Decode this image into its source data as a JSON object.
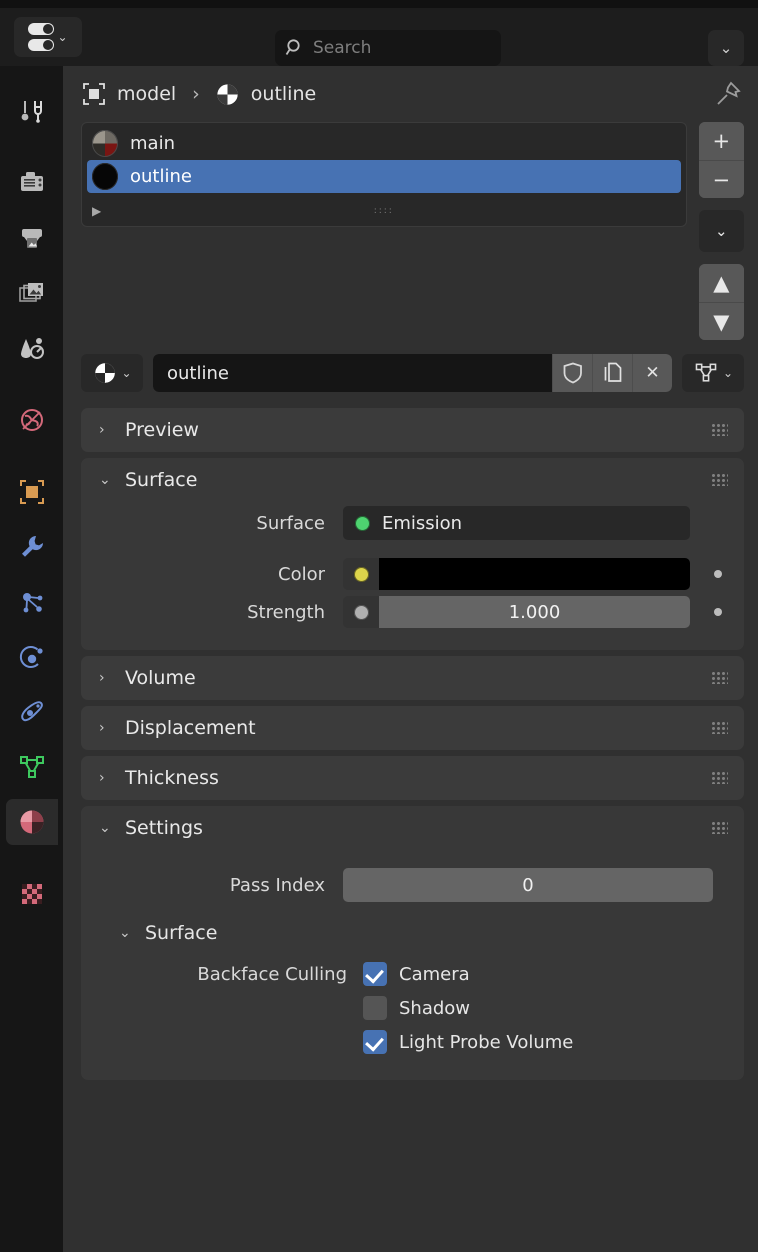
{
  "window": {
    "editor_type_icon": "properties-editor-icon",
    "editor_type_chevron": "⌄"
  },
  "header": {
    "search": {
      "placeholder": "Search",
      "value": "",
      "icon": "search-icon"
    },
    "right_menu_chevron": "⌄"
  },
  "tabs": [
    {
      "name": "tool",
      "icon": "tool-icon",
      "active": false
    },
    {
      "name": "render",
      "icon": "camera-back-icon",
      "active": false
    },
    {
      "name": "output",
      "icon": "printer-icon",
      "active": false
    },
    {
      "name": "view-layer",
      "icon": "images-icon",
      "active": false
    },
    {
      "name": "scene",
      "icon": "cone-droplet-icon",
      "active": false
    },
    {
      "name": "world",
      "icon": "globe-icon",
      "active": false
    },
    {
      "name": "object",
      "icon": "object-square-icon",
      "active": false
    },
    {
      "name": "modifiers",
      "icon": "wrench-icon",
      "active": false
    },
    {
      "name": "particles",
      "icon": "particles-icon",
      "active": false
    },
    {
      "name": "physics",
      "icon": "physics-orbit-icon",
      "active": false
    },
    {
      "name": "object-constraints",
      "icon": "constraint-icon",
      "active": false
    },
    {
      "name": "object-data",
      "icon": "mesh-data-icon",
      "active": false
    },
    {
      "name": "material",
      "icon": "material-sphere-icon",
      "active": true
    },
    {
      "name": "texture",
      "icon": "checker-texture-icon",
      "active": false
    }
  ],
  "breadcrumb": {
    "object_icon": "object-square-icon",
    "object_name": "model",
    "separator": "›",
    "material_icon": "material-sphere-icon",
    "material_name": "outline",
    "pin_icon": "pin-icon"
  },
  "material_slots": {
    "items": [
      {
        "name": "main",
        "preview": "sphere-preview-grey-red",
        "selected": false
      },
      {
        "name": "outline",
        "preview": "sphere-preview-black",
        "selected": true
      }
    ],
    "footer": {
      "expand_arrow": "▶",
      "grip": "::::"
    },
    "buttons": {
      "add": "+",
      "remove": "−",
      "specials_chevron": "⌄",
      "move_up": "▲",
      "move_down": "▼"
    }
  },
  "material_id": {
    "browse_icon": "material-sphere-icon",
    "browse_chevron": "⌄",
    "name_value": "outline",
    "fake_user_icon": "shield-icon",
    "duplicate_icon": "copy-icon",
    "unlink_icon": "✕",
    "link_icon": "mesh-data-icon",
    "link_chevron": "⌄"
  },
  "panels": [
    {
      "name": "preview",
      "title": "Preview",
      "open": false
    },
    {
      "name": "surface",
      "title": "Surface",
      "open": true
    },
    {
      "name": "volume",
      "title": "Volume",
      "open": false
    },
    {
      "name": "displacement",
      "title": "Displacement",
      "open": false
    },
    {
      "name": "thickness",
      "title": "Thickness",
      "open": false
    },
    {
      "name": "settings",
      "title": "Settings",
      "open": true
    }
  ],
  "surface": {
    "shader_label": "Surface",
    "shader_value": "Emission",
    "shader_socket_color": "#4ed470",
    "color_label": "Color",
    "color_socket_color": "#dcd44b",
    "color_value": "#000000",
    "strength_label": "Strength",
    "strength_socket_color": "#b0b0b0",
    "strength_value": "1.000"
  },
  "settings": {
    "pass_index_label": "Pass Index",
    "pass_index_value": "0",
    "surface_subpanel_title": "Surface",
    "backface_culling_label": "Backface Culling",
    "checkboxes": [
      {
        "name": "camera",
        "label": "Camera",
        "checked": true
      },
      {
        "name": "shadow",
        "label": "Shadow",
        "checked": false
      },
      {
        "name": "light-probe-volume",
        "label": "Light Probe Volume",
        "checked": true
      }
    ]
  },
  "colors": {
    "accent_select": "#4772b3",
    "panel_bg": "#3b3b3b",
    "region_bg": "#303030",
    "tabstrip_bg": "#161616",
    "field_dark": "#151515",
    "field_grey": "#656565",
    "material_tab_icon": "#d4697a",
    "object_tab_icon": "#d99b52",
    "modifier_tab_icon": "#6e8fd4",
    "data_tab_icon": "#3ec95f"
  },
  "arrows": {
    "closed": "›",
    "open": "⌄"
  }
}
